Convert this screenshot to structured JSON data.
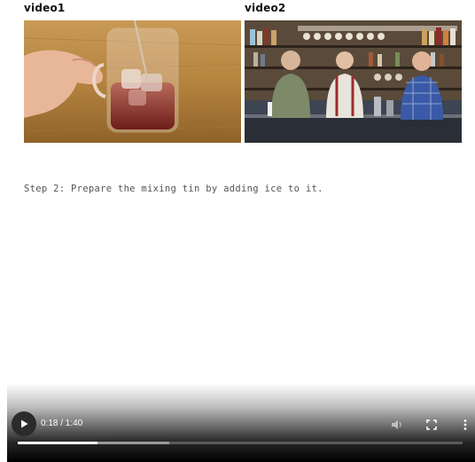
{
  "videos": [
    {
      "label": "video1"
    },
    {
      "label": "video2"
    }
  ],
  "step": {
    "text": "Step 2: Prepare the mixing tin by adding ice to it."
  },
  "player": {
    "current_time": "0:18",
    "duration": "1:40",
    "time_display": "0:18 / 1:40",
    "played_fraction": 0.18,
    "buffered_fraction": 0.34,
    "icons": {
      "play": "play-icon",
      "volume": "volume-icon",
      "fullscreen": "fullscreen-icon",
      "more": "more-vert-icon"
    }
  }
}
